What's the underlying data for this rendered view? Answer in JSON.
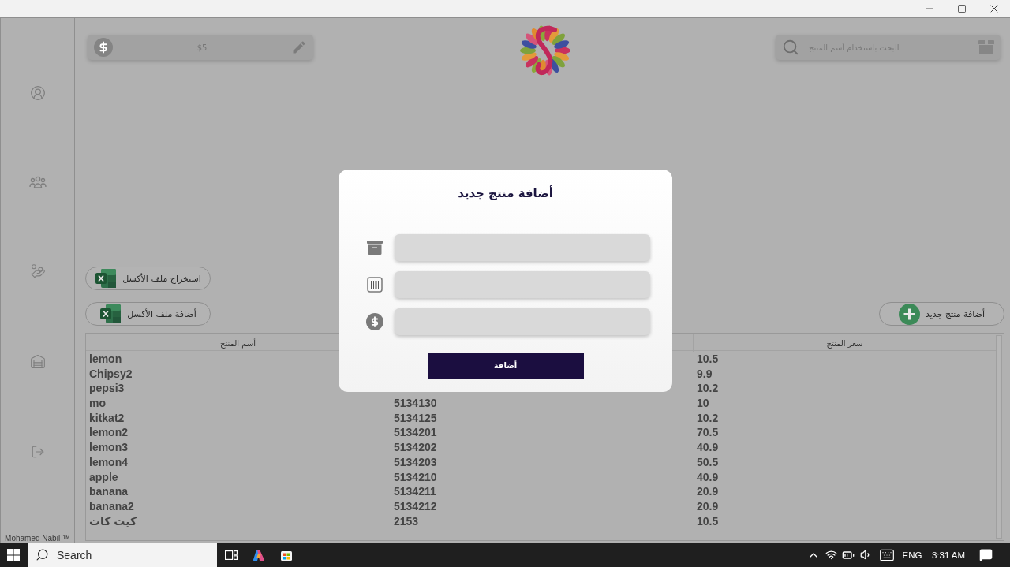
{
  "toolbar": {
    "balance_field": {
      "value": "$5"
    },
    "search_field": {
      "placeholder": "البحث باستخدام أسم المنتج"
    }
  },
  "sidebar": {
    "footer": "Mohamed Nabil ™"
  },
  "excel_buttons": [
    {
      "label": "استخراج ملف الأكسل"
    },
    {
      "label": "أضافة ملف الأكسل"
    }
  ],
  "add_product_button": {
    "label": "أضافة منتج جديد"
  },
  "table": {
    "header": {
      "name": "أسم المنتج",
      "price": "سعر المنتج"
    },
    "rows": [
      {
        "name": "lemon",
        "price": "10.5"
      },
      {
        "name": "Chipsy2",
        "price": "9.9"
      },
      {
        "name": "pepsi3",
        "price": "10.2"
      },
      {
        "name": "mo",
        "column_2": "5134130",
        "price": "10"
      },
      {
        "name": "kitkat2",
        "column_2": "5134125",
        "price": "10.2"
      },
      {
        "name": "lemon2",
        "column_2": "5134201",
        "price": "70.5"
      },
      {
        "name": "lemon3",
        "column_2": "5134202",
        "price": "40.9"
      },
      {
        "name": "lemon4",
        "column_2": "5134203",
        "price": "50.5"
      },
      {
        "name": "apple",
        "column_2": "5134210",
        "price": "40.9"
      },
      {
        "name": "banana",
        "column_2": "5134211",
        "price": "20.9"
      },
      {
        "name": "banana2",
        "column_2": "5134212",
        "price": "20.9"
      },
      {
        "name": "كيت كات",
        "column_2": "2153",
        "price": "10.5"
      }
    ]
  },
  "dialog": {
    "title": "أضافة منتج جديد",
    "fields": [
      {
        "kind": "name"
      },
      {
        "kind": "barcode"
      },
      {
        "kind": "price"
      }
    ],
    "submit_button": {
      "label": "أضافة"
    }
  },
  "taskbar": {
    "search": {
      "placeholder": "Search"
    },
    "language": "ENG",
    "time": "3:31 AM"
  }
}
